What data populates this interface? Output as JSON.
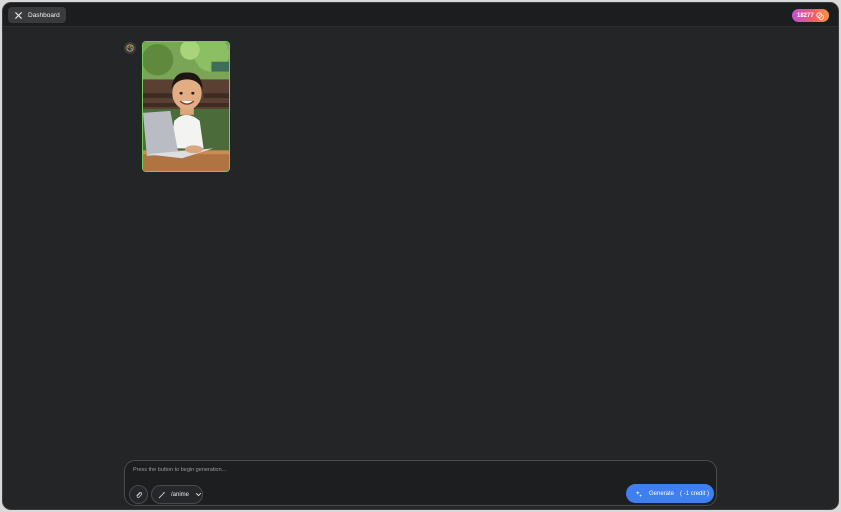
{
  "header": {
    "dashboard_label": "Dashboard",
    "credits_count": "18277"
  },
  "gallery": {
    "items": [
      {
        "selected": true,
        "accent": "#6fcf5a"
      }
    ]
  },
  "composer": {
    "placeholder": "Press the button to begin generation...",
    "model_label": "/anime",
    "generate_label": "Generate",
    "generate_cost": "( -1 credit )"
  },
  "colors": {
    "background": "#242526",
    "generate_button": "#3f7ff0",
    "selected_border": "#6fcf5a"
  }
}
